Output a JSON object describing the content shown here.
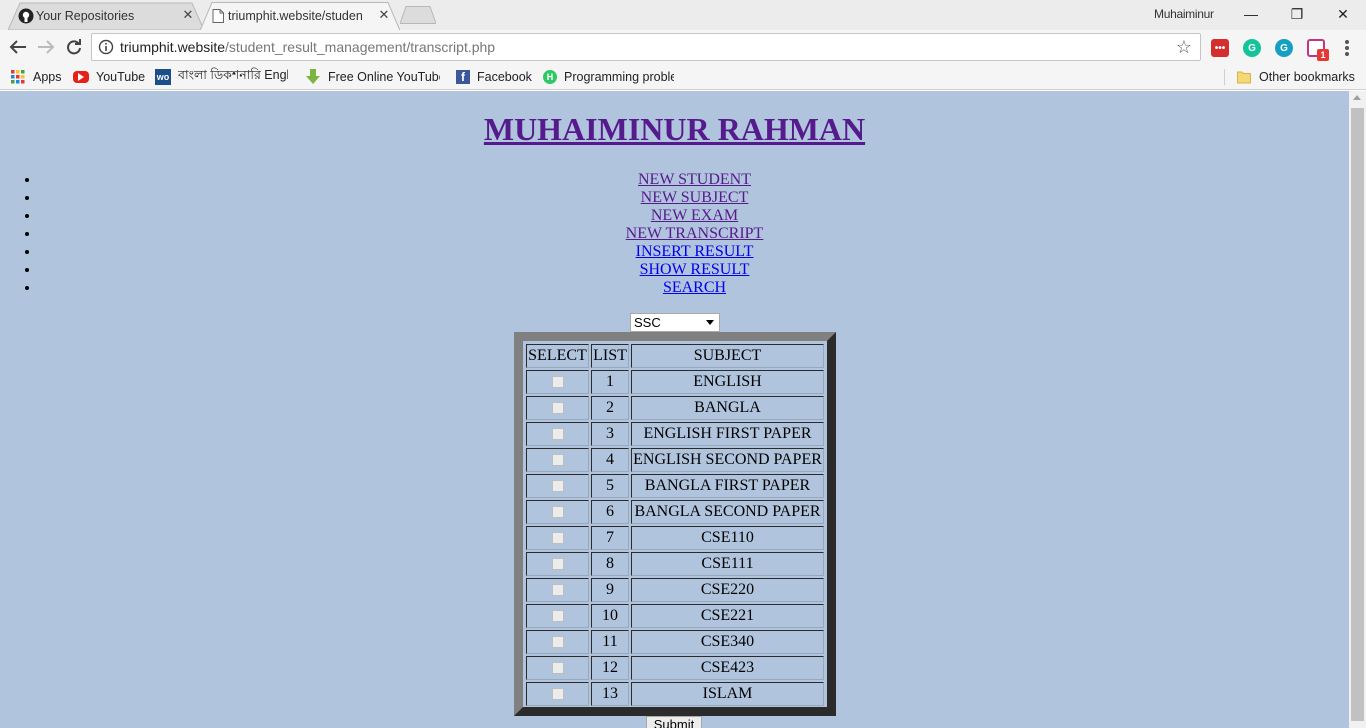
{
  "browser": {
    "tabs": [
      {
        "title": "Your Repositories",
        "close": "✕"
      },
      {
        "title": "triumphit.website/studen",
        "close": "✕"
      }
    ],
    "profile_name": "Muhaiminur",
    "window_controls": {
      "minimize": "—",
      "restore": "❐",
      "close": "✕"
    },
    "url_host": "triumphit.website",
    "url_path": "/student_result_management/transcript.php",
    "star_icon": "☆",
    "extension_badge": "1",
    "bookmarks": [
      {
        "label": "Apps",
        "icon": "apps-grid-icon"
      },
      {
        "label": "YouTube",
        "icon": "youtube-icon"
      },
      {
        "label": "বাংলা ডিকশনারি Engl",
        "icon": "wordweb-icon"
      },
      {
        "label": "Free Online YouTube",
        "icon": "download-arrow-icon"
      },
      {
        "label": "Facebook",
        "icon": "facebook-icon"
      },
      {
        "label": "Programming proble",
        "icon": "hackerrank-icon"
      }
    ],
    "other_bookmarks": "Other bookmarks"
  },
  "page": {
    "background": "#b0c4de",
    "title": "MUHAIMINUR RAHMAN",
    "nav": [
      {
        "label": "NEW STUDENT",
        "visited": true
      },
      {
        "label": "NEW SUBJECT",
        "visited": true
      },
      {
        "label": "NEW EXAM",
        "visited": true
      },
      {
        "label": "NEW TRANSCRIPT",
        "visited": true
      },
      {
        "label": "INSERT RESULT",
        "visited": false
      },
      {
        "label": "SHOW RESULT",
        "visited": false
      },
      {
        "label": "SEARCH",
        "visited": false
      }
    ],
    "exam_select": {
      "selected": "SSC"
    },
    "table": {
      "headers": [
        "SELECT",
        "LIST",
        "SUBJECT"
      ],
      "rows": [
        {
          "list": "1",
          "subject": "ENGLISH"
        },
        {
          "list": "2",
          "subject": "BANGLA"
        },
        {
          "list": "3",
          "subject": "ENGLISH FIRST PAPER"
        },
        {
          "list": "4",
          "subject": "ENGLISH SECOND PAPER"
        },
        {
          "list": "5",
          "subject": "BANGLA FIRST PAPER"
        },
        {
          "list": "6",
          "subject": "BANGLA SECOND PAPER"
        },
        {
          "list": "7",
          "subject": "CSE110"
        },
        {
          "list": "8",
          "subject": "CSE111"
        },
        {
          "list": "9",
          "subject": "CSE220"
        },
        {
          "list": "10",
          "subject": "CSE221"
        },
        {
          "list": "11",
          "subject": "CSE340"
        },
        {
          "list": "12",
          "subject": "CSE423"
        },
        {
          "list": "13",
          "subject": "ISLAM"
        }
      ]
    },
    "submit_label": "Submit"
  }
}
